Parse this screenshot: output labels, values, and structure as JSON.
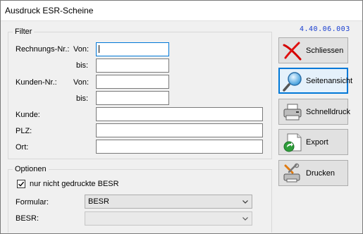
{
  "window": {
    "title": "Ausdruck ESR-Scheine",
    "version": "4.40.06.003"
  },
  "filter": {
    "legend": "Filter",
    "rechnungs_label": "Rechnungs-Nr.:",
    "von_label": "Von:",
    "bis_label": "bis:",
    "kunden_label": "Kunden-Nr.:",
    "kunde_label": "Kunde:",
    "plz_label": "PLZ:",
    "ort_label": "Ort:",
    "rechnung_von_value": "",
    "rechnung_bis_value": "",
    "kunden_von_value": "",
    "kunden_bis_value": "",
    "kunde_value": "",
    "plz_value": "",
    "ort_value": ""
  },
  "optionen": {
    "legend": "Optionen",
    "checkbox_label": "nur nicht gedruckte BESR",
    "checkbox_checked": true,
    "formular_label": "Formular:",
    "formular_value": "BESR",
    "besr_label": "BESR:",
    "besr_value": ""
  },
  "buttons": {
    "schliessen": {
      "label": "Schliessen",
      "icon": "red-x-icon"
    },
    "seitenansicht": {
      "label": "Seitenansicht",
      "icon": "magnifier-icon"
    },
    "schnelldruck": {
      "label": "Schnelldruck",
      "icon": "printer-icon"
    },
    "export": {
      "label": "Export",
      "icon": "export-icon"
    },
    "drucken": {
      "label": "Drucken",
      "icon": "tools-print-icon"
    }
  },
  "colors": {
    "accent": "#0078d7",
    "version_text": "#1a3fd0"
  }
}
